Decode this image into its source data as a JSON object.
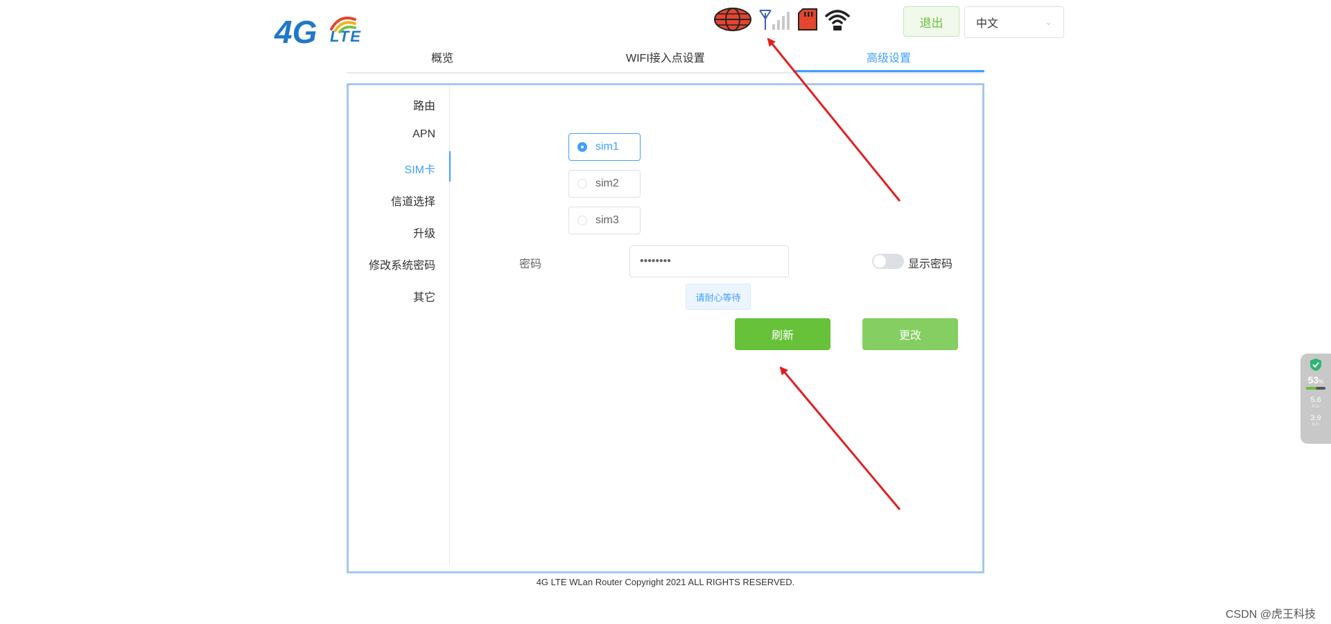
{
  "header": {
    "logo_text": "4G LTE",
    "logout_label": "退出",
    "language": "中文",
    "status_icons": [
      "globe-icon",
      "signal-antenna-icon",
      "sd-card-icon",
      "wifi-icon"
    ]
  },
  "tabs": [
    {
      "label": "概览",
      "active": false
    },
    {
      "label": "WIFI接入点设置",
      "active": false
    },
    {
      "label": "高级设置",
      "active": true
    }
  ],
  "side_menu": [
    {
      "label": "路由",
      "active": false
    },
    {
      "label": "APN",
      "active": false
    },
    {
      "label": "SIM卡",
      "active": true
    },
    {
      "label": "信道选择",
      "active": false
    },
    {
      "label": "升级",
      "active": false
    },
    {
      "label": "修改系统密码",
      "active": false
    },
    {
      "label": "其它",
      "active": false
    }
  ],
  "sim_options": [
    {
      "label": "sim1",
      "checked": true
    },
    {
      "label": "sim2",
      "checked": false
    },
    {
      "label": "sim3",
      "checked": false
    }
  ],
  "password": {
    "label": "密码",
    "value": "••••••••",
    "show_toggle_label": "显示密码",
    "show": false
  },
  "wait_tip": "请耐心等待",
  "buttons": {
    "refresh": "刷新",
    "change": "更改"
  },
  "footer": "4G LTE WLan Router Copyright 2021 ALL RIGHTS RESERVED.",
  "net_widget": {
    "percent": "53",
    "percent_unit": "%",
    "upload": "5.6",
    "download": "3.9",
    "unit": "K/s"
  },
  "watermark": "CSDN @虎王科技",
  "colors": {
    "accent": "#409eff",
    "success": "#67c23a",
    "success_light": "#85ce61",
    "panel_border": "#a4c8ef",
    "arrow": "#e02020"
  }
}
